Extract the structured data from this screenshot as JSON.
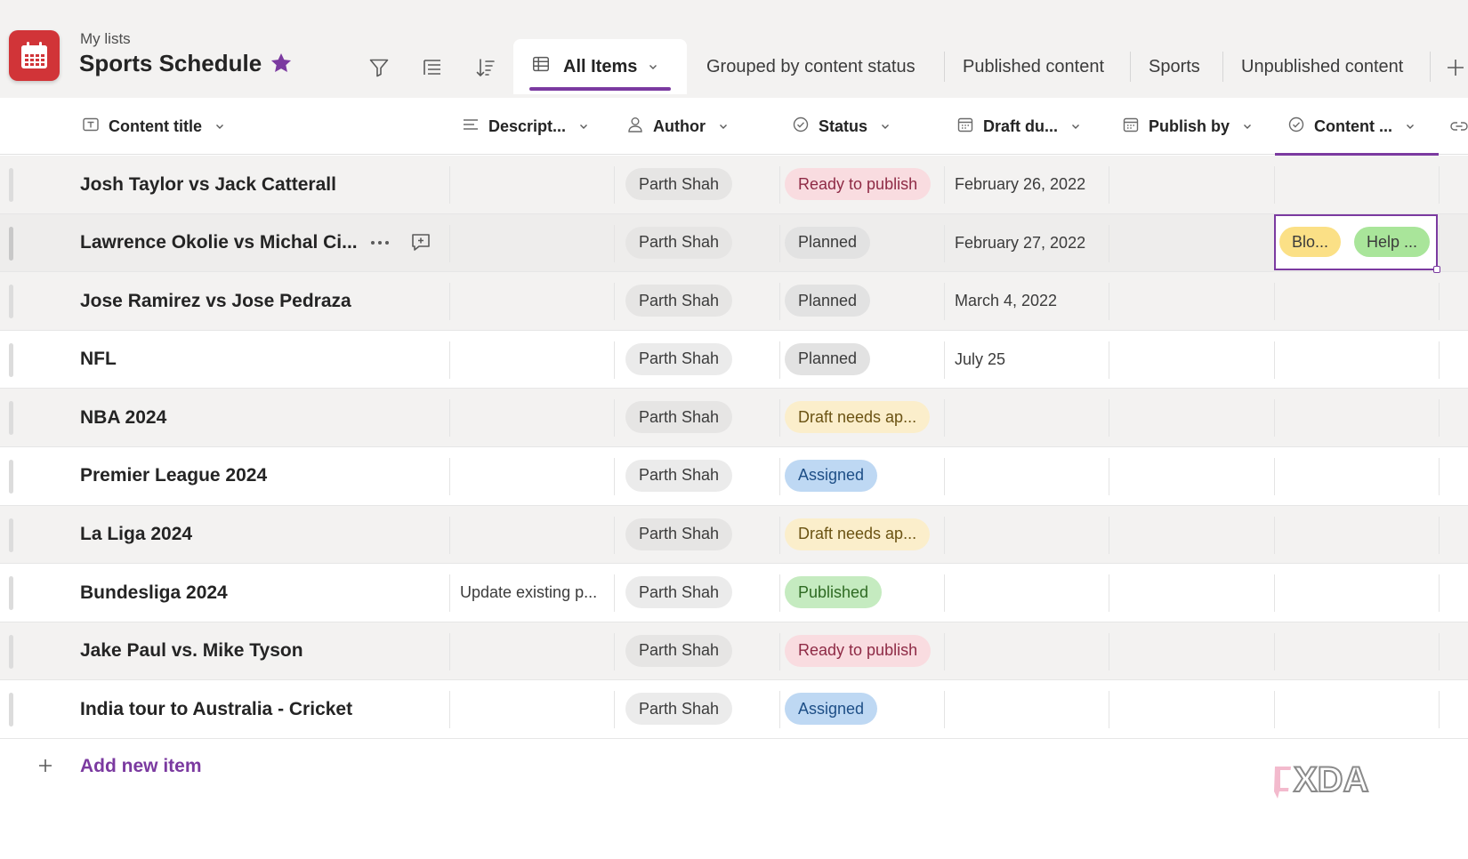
{
  "header": {
    "breadcrumb": "My lists",
    "title": "Sports Schedule",
    "toolbar": [
      "filter-icon",
      "group-by-icon",
      "sort-icon"
    ]
  },
  "views": {
    "active": "All Items",
    "tabs": [
      "Grouped by content status",
      "Published content",
      "Sports",
      "Unpublished content"
    ]
  },
  "columns": {
    "title": "Content title",
    "description": "Descript...",
    "author": "Author",
    "status": "Status",
    "draft_due": "Draft du...",
    "publish_by": "Publish by",
    "content_type": "Content ..."
  },
  "rows": [
    {
      "title": "Josh Taylor vs Jack Catterall",
      "description": "",
      "author": "Parth Shah",
      "status": "Ready to publish",
      "draft_due": "February 26, 2022"
    },
    {
      "title": "Lawrence Okolie vs Michal Ci...",
      "description": "",
      "author": "Parth Shah",
      "status": "Planned",
      "draft_due": "February 27, 2022"
    },
    {
      "title": "Jose Ramirez vs Jose Pedraza",
      "description": "",
      "author": "Parth Shah",
      "status": "Planned",
      "draft_due": "March 4, 2022"
    },
    {
      "title": "NFL",
      "description": "",
      "author": "Parth Shah",
      "status": "Planned",
      "draft_due": "July 25"
    },
    {
      "title": "NBA 2024",
      "description": "",
      "author": "Parth Shah",
      "status": "Draft needs ap...",
      "draft_due": ""
    },
    {
      "title": "Premier League 2024",
      "description": "",
      "author": "Parth Shah",
      "status": "Assigned",
      "draft_due": ""
    },
    {
      "title": "La Liga 2024",
      "description": "",
      "author": "Parth Shah",
      "status": "Draft needs ap...",
      "draft_due": ""
    },
    {
      "title": "Bundesliga 2024",
      "description": "Update existing p...",
      "author": "Parth Shah",
      "status": "Published",
      "draft_due": ""
    },
    {
      "title": "Jake Paul vs. Mike Tyson",
      "description": "",
      "author": "Parth Shah",
      "status": "Ready to publish",
      "draft_due": ""
    },
    {
      "title": "India tour to Australia - Cricket",
      "description": "",
      "author": "Parth Shah",
      "status": "Assigned",
      "draft_due": ""
    }
  ],
  "selected_cell": {
    "tags": [
      "Blo...",
      "Help ..."
    ]
  },
  "status_colors": {
    "Ready to publish": {
      "bg": "#f9dce0",
      "fg": "#8e2a45"
    },
    "Planned": {
      "bg": "#e2e2e2",
      "fg": "#3b3b3b"
    },
    "Draft needs ap...": {
      "bg": "#fbeecb",
      "fg": "#6b5313"
    },
    "Assigned": {
      "bg": "#bed8f3",
      "fg": "#1d4e86"
    },
    "Published": {
      "bg": "#c5ebc0",
      "fg": "#2e6a22"
    }
  },
  "tag_colors": {
    "Blo...": "#fbe086",
    "Help ...": "#a9e59a"
  },
  "footer": {
    "add_label": "Add new item"
  },
  "accent": "#7b3aa0",
  "watermark": "XDA"
}
